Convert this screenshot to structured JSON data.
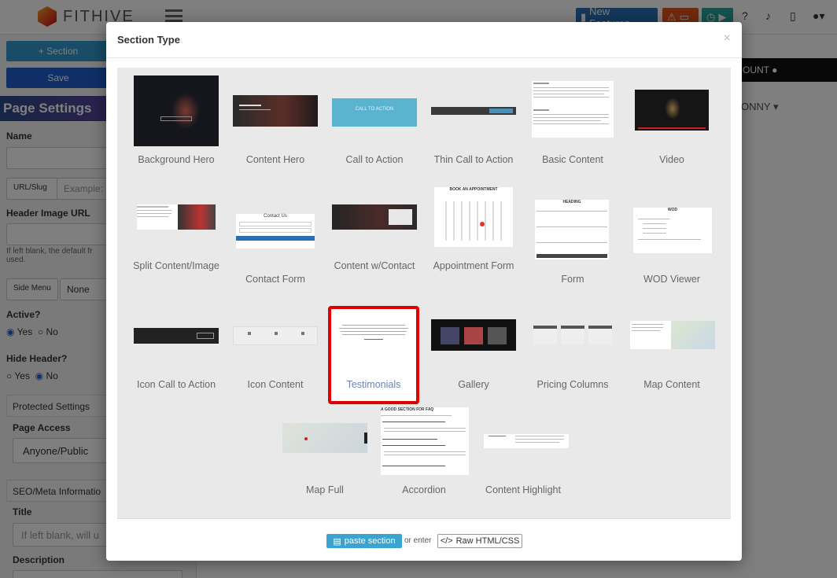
{
  "app": {
    "brand": "FITHIVE"
  },
  "topbar": {
    "new_features": "New Features"
  },
  "sidebar": {
    "section_button": "+ Section",
    "save_button": "Save",
    "heading": "Page Settings",
    "name_label": "Name",
    "url_slug_label": "URL/Slug",
    "url_slug_placeholder": "Example: s",
    "header_image_label": "Header Image URL",
    "header_image_help": "If left blank, the default fr used.",
    "side_menu_label": "Side Menu",
    "side_menu_value": "None",
    "active_label": "Active?",
    "active_yes": "Yes",
    "active_no": "No",
    "hide_header_label": "Hide Header?",
    "hide_yes": "Yes",
    "hide_no": "No",
    "protected_label": "Protected Settings",
    "page_access_label": "Page Access",
    "page_access_value": "Anyone/Public",
    "seo_label": "SEO/Meta Informatio",
    "title_label": "Title",
    "title_placeholder": "If left blank, will u",
    "description_label": "Description"
  },
  "right": {
    "account": "OUNT",
    "user": "ONNY"
  },
  "modal": {
    "title": "Section Type",
    "close": "×",
    "paste_button": "paste section",
    "or_enter": "or enter",
    "raw_button": "Raw HTML/CSS",
    "sections": [
      "Background Hero",
      "Content Hero",
      "Call to Action",
      "Thin Call to Action",
      "Basic Content",
      "Video",
      "Split Content/Image",
      "Contact Form",
      "Content w/Contact",
      "Appointment Form",
      "Form",
      "WOD Viewer",
      "Icon Call to Action",
      "Icon Content",
      "Testimonials",
      "Gallery",
      "Pricing Columns",
      "Map Content",
      "Map Full",
      "Accordion",
      "Content Highlight"
    ],
    "thumb_text": {
      "cta": "CALL TO ACTION",
      "appointment": "BOOK AN APPOINTMENT",
      "form": "HEADING",
      "wod": "WOD",
      "contact": "Contact Us",
      "faq": "A GOOD SECTION FOR FAQ"
    },
    "selected": "Testimonials"
  }
}
